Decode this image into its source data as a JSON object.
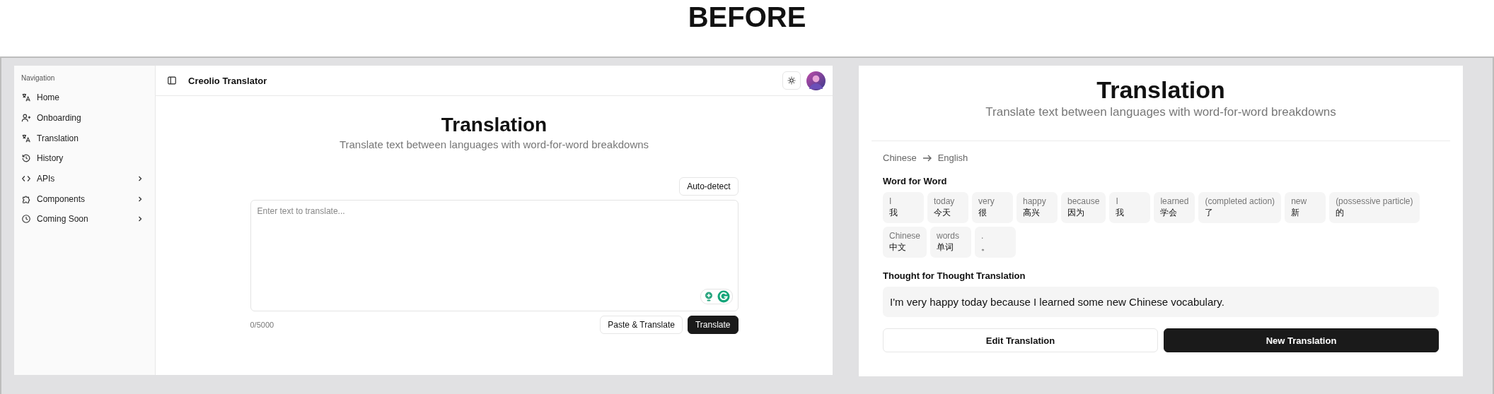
{
  "caption": "BEFORE",
  "left_app": {
    "sidebar": {
      "heading": "Navigation",
      "items": [
        {
          "label": "Home",
          "has_submenu": false
        },
        {
          "label": "Onboarding",
          "has_submenu": false
        },
        {
          "label": "Translation",
          "has_submenu": false
        },
        {
          "label": "History",
          "has_submenu": false
        },
        {
          "label": "APIs",
          "has_submenu": true
        },
        {
          "label": "Components",
          "has_submenu": true
        },
        {
          "label": "Coming Soon",
          "has_submenu": true
        }
      ]
    },
    "header": {
      "title": "Creolio Translator"
    },
    "page": {
      "title": "Translation",
      "subtitle": "Translate text between languages with word-for-word breakdowns"
    },
    "language_button": "Auto-detect",
    "input": {
      "placeholder": "Enter text to translate...",
      "counter": "0/5000"
    },
    "buttons": [
      {
        "label": "Paste & Translate",
        "kind": "secondary"
      },
      {
        "label": "Translate",
        "kind": "primary"
      }
    ]
  },
  "right_app": {
    "page": {
      "title": "Translation",
      "subtitle": "Translate text between languages with word-for-word breakdowns"
    },
    "source_language": "Chinese",
    "target_language": "English",
    "word_for_word": {
      "heading": "Word for Word",
      "words": [
        {
          "gloss": "I",
          "word": "我"
        },
        {
          "gloss": "today",
          "word": "今天"
        },
        {
          "gloss": "very",
          "word": "很"
        },
        {
          "gloss": "happy",
          "word": "高兴"
        },
        {
          "gloss": "because",
          "word": "因为"
        },
        {
          "gloss": "I",
          "word": "我"
        },
        {
          "gloss": "learned",
          "word": "学会"
        },
        {
          "gloss": "(completed action)",
          "word": "了"
        },
        {
          "gloss": "new",
          "word": "新"
        },
        {
          "gloss": "(possessive particle)",
          "word": "的"
        },
        {
          "gloss": "Chinese",
          "word": "中文"
        },
        {
          "gloss": "words",
          "word": "单词"
        },
        {
          "gloss": ".",
          "word": "。"
        }
      ]
    },
    "thought_for_thought": {
      "heading": "Thought for Thought Translation",
      "text": "I'm very happy today because I learned some new Chinese vocabulary."
    },
    "buttons": [
      {
        "label": "Edit Translation",
        "kind": "secondary"
      },
      {
        "label": "New Translation",
        "kind": "primary"
      }
    ]
  }
}
